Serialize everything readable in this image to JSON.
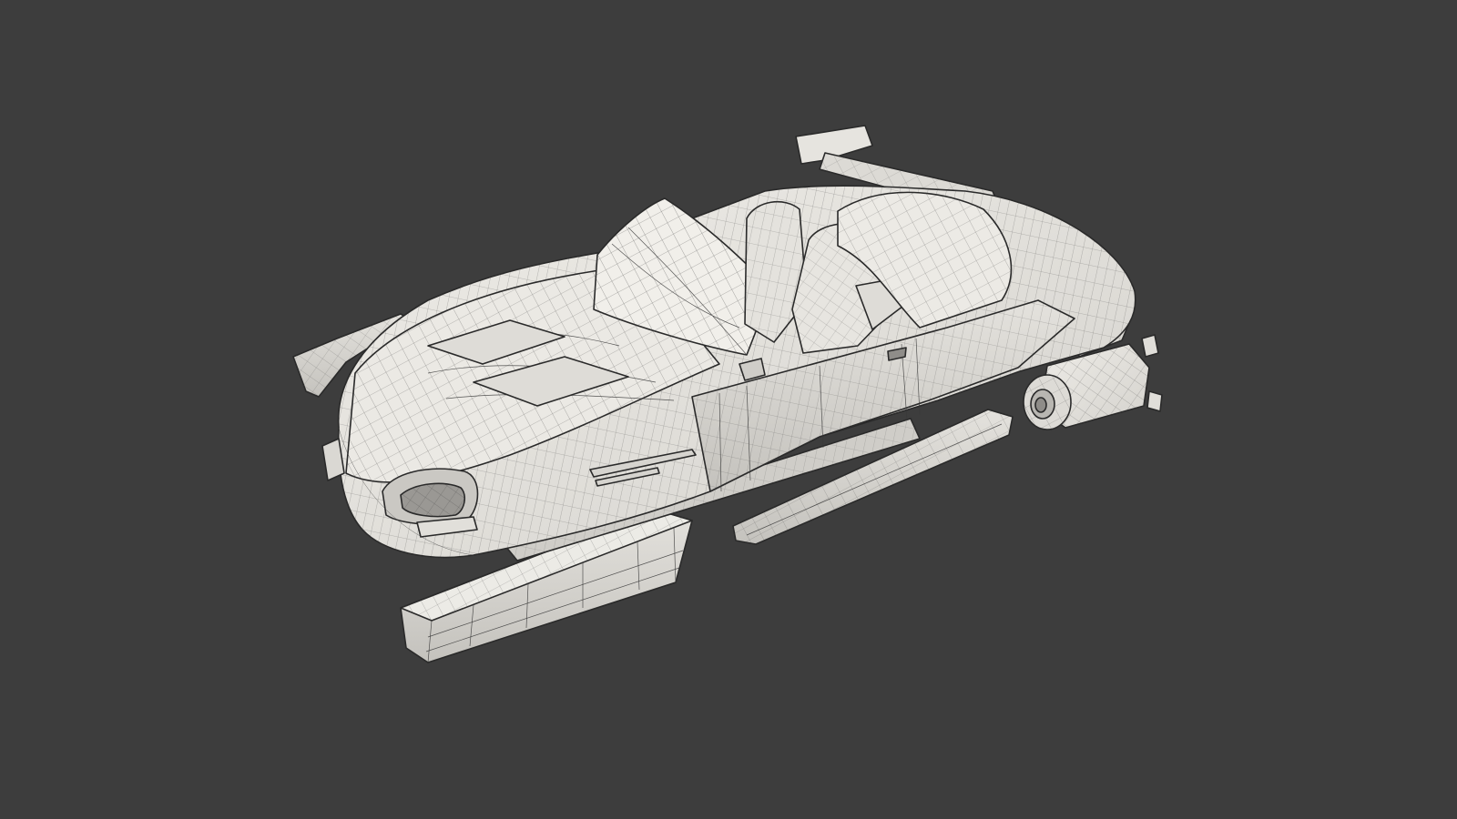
{
  "scene": {
    "subject": "",
    "background_color": "#3d3d3d",
    "surface_color": "#e8e6e1",
    "shade_color": "#c9c7c2",
    "wire_color": "#3a3a3a"
  }
}
